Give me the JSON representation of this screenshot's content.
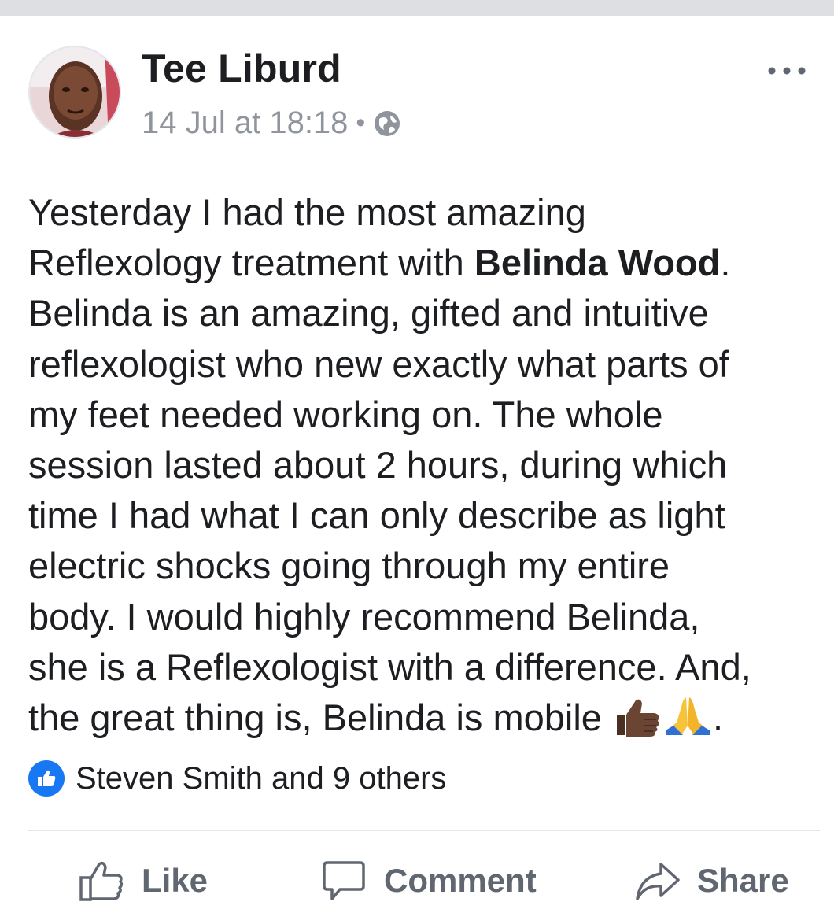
{
  "post": {
    "author": "Tee Liburd",
    "timestamp": "14 Jul at 18:18",
    "separator": "•",
    "privacy_icon": "globe-icon",
    "more_icon": "more-options-icon",
    "body_lines": [
      "Yesterday I had the most amazing",
      "Reflexology treatment with ",
      "Belinda Wood",
      ".",
      "Belinda is an amazing, gifted and intuitive",
      "reflexologist who new exactly what parts of",
      "my feet needed working on. The whole",
      "session lasted about 2 hours, during which",
      "time I had what I can only describe as light",
      "electric shocks going through my entire",
      "body. I would highly recommend Belinda,",
      "she is a Reflexologist with a difference. And,",
      "the great thing is, Belinda is mobile ",
      "."
    ],
    "reactions_text": "Steven Smith and 9 others"
  },
  "actions": {
    "like_label": "Like",
    "comment_label": "Comment",
    "share_label": "Share"
  },
  "colors": {
    "brand_blue": "#1877f2",
    "meta_gray": "#90949c",
    "action_gray": "#606770"
  }
}
